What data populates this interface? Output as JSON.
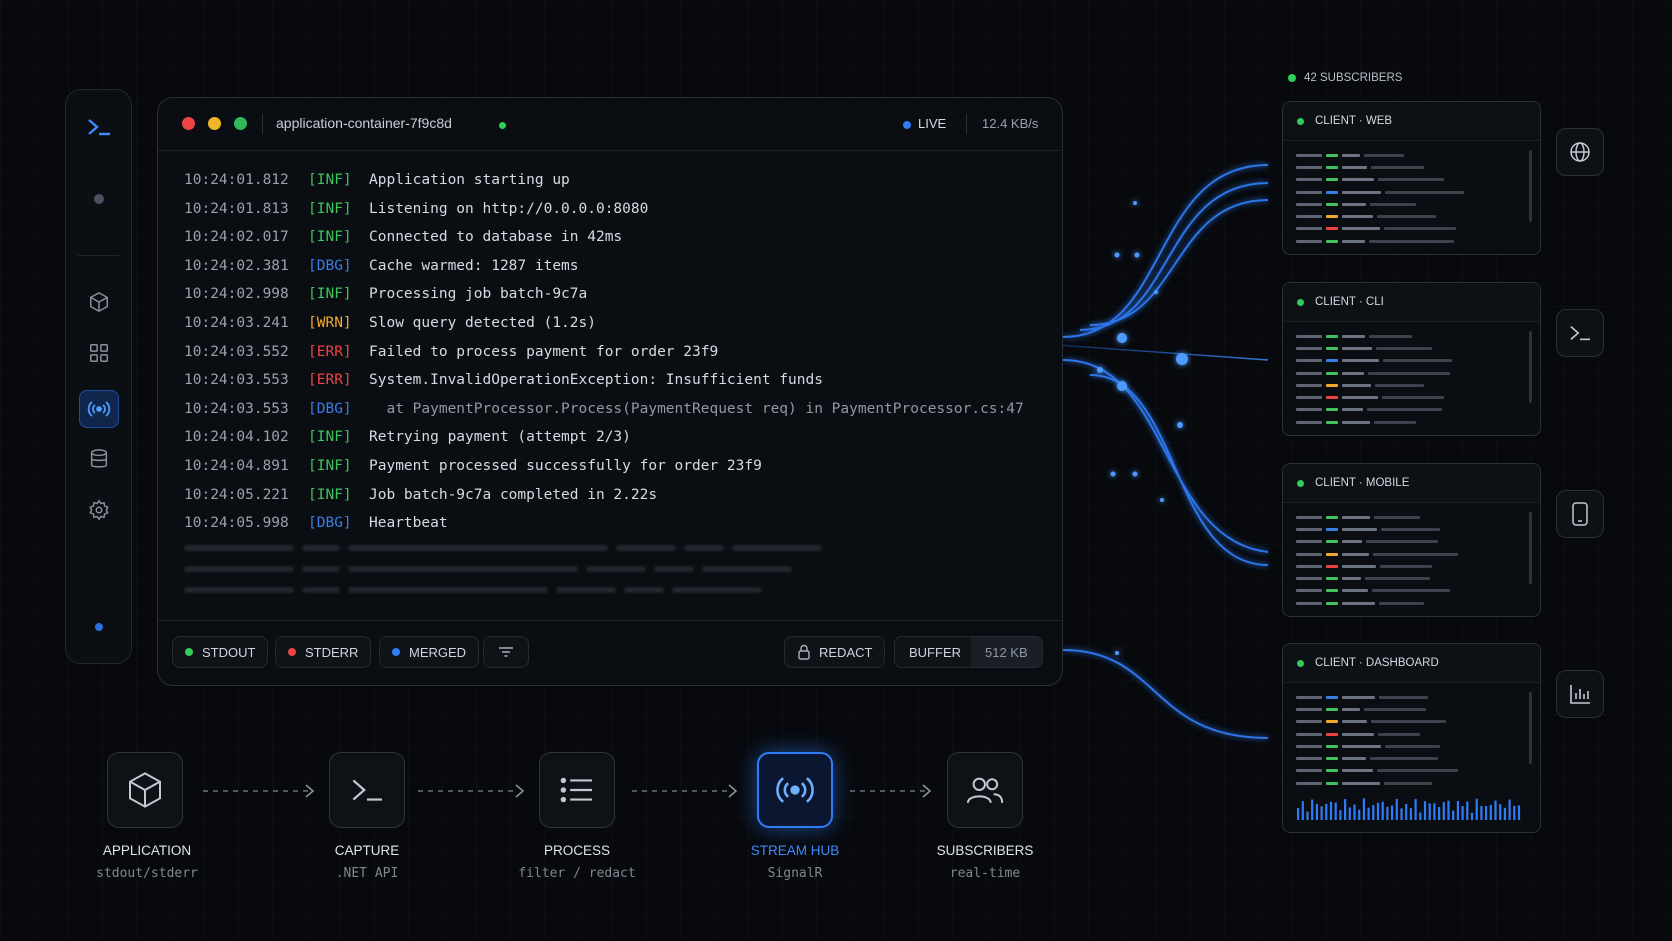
{
  "colors": {
    "accent": "#2e7cf6",
    "info": "#3fc35f",
    "debug": "#3a7ee8",
    "warn": "#f0a92a",
    "error": "#ef4444"
  },
  "sidebar": {
    "items": [
      {
        "icon": "terminal-icon"
      },
      {
        "icon": "status-dot"
      },
      {
        "icon": "cube-icon"
      },
      {
        "icon": "layout-icon"
      },
      {
        "icon": "broadcast-icon",
        "active": true
      },
      {
        "icon": "database-icon"
      },
      {
        "icon": "gear-icon"
      },
      {
        "icon": "status-dot"
      }
    ]
  },
  "terminal": {
    "container_name": "application-container-7f9c8d",
    "live_label": "LIVE",
    "rate": "12.4 KB/s",
    "logs": [
      {
        "ts": "10:24:01.812",
        "level": "[INF]",
        "msg": "Application starting up"
      },
      {
        "ts": "10:24:01.813",
        "level": "[INF]",
        "msg": "Listening on http://0.0.0.0:8080"
      },
      {
        "ts": "10:24:02.017",
        "level": "[INF]",
        "msg": "Connected to database in 42ms"
      },
      {
        "ts": "10:24:02.381",
        "level": "[DBG]",
        "msg": "Cache warmed: 1287 items"
      },
      {
        "ts": "10:24:02.998",
        "level": "[INF]",
        "msg": "Processing job batch-9c7a"
      },
      {
        "ts": "10:24:03.241",
        "level": "[WRN]",
        "msg": "Slow query detected (1.2s)"
      },
      {
        "ts": "10:24:03.552",
        "level": "[ERR]",
        "msg": "Failed to process payment for order 23f9"
      },
      {
        "ts": "10:24:03.553",
        "level": "[ERR]",
        "msg": "System.InvalidOperationException: Insufficient funds"
      },
      {
        "ts": "10:24:03.553",
        "level": "[DBG]",
        "msg": "  at PaymentProcessor.Process(PaymentRequest req) in PaymentProcessor.cs:47"
      },
      {
        "ts": "10:24:04.102",
        "level": "[INF]",
        "msg": "Retrying payment (attempt 2/3)"
      },
      {
        "ts": "10:24:04.891",
        "level": "[INF]",
        "msg": "Payment processed successfully for order 23f9"
      },
      {
        "ts": "10:24:05.221",
        "level": "[INF]",
        "msg": "Job batch-9c7a completed in 2.22s"
      },
      {
        "ts": "10:24:05.998",
        "level": "[DBG]",
        "msg": "Heartbeat"
      }
    ],
    "toolbar": {
      "stdout": "STDOUT",
      "stderr": "STDERR",
      "merged": "MERGED",
      "filter_icon": "filter-icon",
      "redact": "REDACT",
      "buffer_label": "BUFFER",
      "buffer_value": "512 KB"
    }
  },
  "subscribers": {
    "header": "42 SUBSCRIBERS",
    "clients": [
      {
        "label": "CLIENT · WEB",
        "icon": "globe-icon"
      },
      {
        "label": "CLIENT · CLI",
        "icon": "terminal-icon"
      },
      {
        "label": "CLIENT · MOBILE",
        "icon": "phone-icon"
      },
      {
        "label": "CLIENT · DASHBOARD",
        "icon": "bar-chart-icon"
      }
    ]
  },
  "pipeline": {
    "stages": [
      {
        "label": "APPLICATION",
        "sub": "stdout/stderr",
        "icon": "cube-icon"
      },
      {
        "label": "CAPTURE",
        "sub": ".NET API",
        "icon": "terminal-icon"
      },
      {
        "label": "PROCESS",
        "sub": "filter / redact",
        "icon": "list-icon"
      },
      {
        "label": "STREAM HUB",
        "sub": "SignalR",
        "icon": "broadcast-icon",
        "active": true
      },
      {
        "label": "SUBSCRIBERS",
        "sub": "real-time",
        "icon": "users-icon"
      }
    ]
  }
}
